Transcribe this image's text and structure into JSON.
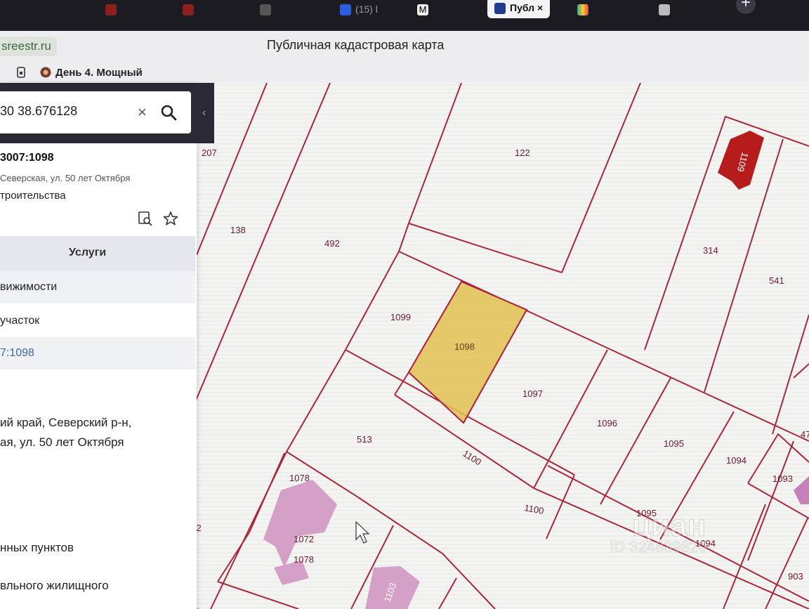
{
  "browser": {
    "tabs": [
      {
        "label": "",
        "icon": "red-dot-icon"
      },
      {
        "label": "",
        "icon": "red-dot-icon"
      },
      {
        "label": "",
        "icon": "red-dot-icon"
      },
      {
        "label": "",
        "icon": "gray-dot-icon"
      },
      {
        "label": "(15) l",
        "icon": "blue-app-icon"
      },
      {
        "label": "",
        "icon": "m-logo-icon"
      },
      {
        "label": "Публ",
        "icon": "rosreestr-icon",
        "active": true
      },
      {
        "label": "",
        "icon": "color-dots-icon"
      },
      {
        "label": "",
        "icon": "puzzle-icon"
      }
    ],
    "active_tab_close": "×",
    "new_tab": "+",
    "domain": "sreestr.ru",
    "page_title": "Публичная кадастровая карта",
    "bookmark": "День 4. Мощный"
  },
  "sidebar": {
    "search_value": "30 38.676128",
    "clear": "×",
    "card": {
      "id": "3007:1098",
      "address": "Северская, ул. 50 лет Октября",
      "type": "троительства"
    },
    "services_header": "Услуги",
    "services": [
      "вижимости",
      "участок",
      "7:1098"
    ],
    "details": [
      "ий край, Северский р-н,",
      "ая, ул. 50 лет Октября",
      "нных пунктов",
      "вльного жилищного"
    ]
  },
  "map": {
    "parcels": [
      "207",
      "122",
      "1109",
      "138",
      "492",
      "314",
      "541",
      "1099",
      "1098",
      "1097",
      "1096",
      "1095",
      "513",
      "1100",
      "1100",
      "1094",
      "1093",
      "1078",
      "1072",
      "1078",
      "492",
      "1095",
      "1094",
      "903",
      "47",
      "1103"
    ],
    "watermark": "циан",
    "watermark_id": "ID 324839820",
    "colors": {
      "highlight": "#e2c052",
      "building": "#d4a0c8",
      "building_red": "#b71c1c",
      "lines": "#a8283c"
    }
  }
}
